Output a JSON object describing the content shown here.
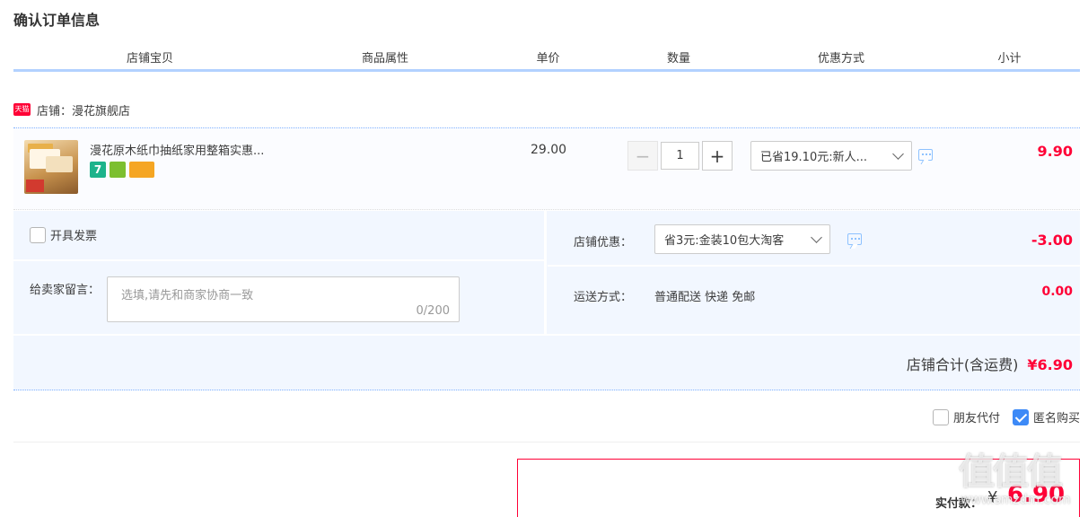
{
  "page": {
    "title": "确认订单信息"
  },
  "columns": [
    "店铺宝贝",
    "商品属性",
    "单价",
    "数量",
    "优惠方式",
    "小计"
  ],
  "shop": {
    "logo_text": "天猫",
    "label": "店铺：漫花旗舰店"
  },
  "item": {
    "title": "漫花原木纸巾抽纸家用整箱实惠...",
    "badge_seven": "7",
    "unit_price": "29.00",
    "quantity": "1",
    "qty_minus": "−",
    "qty_plus": "+",
    "discount_option": "已省19.10元:新人...",
    "subtotal": "9.90"
  },
  "invoice": {
    "label": "开具发票",
    "checked": false
  },
  "message": {
    "label": "给卖家留言：",
    "placeholder": "选填,请先和商家协商一致",
    "counter": "0/200"
  },
  "shop_discount": {
    "label": "店铺优惠：",
    "option": "省3元:金装10包大淘客",
    "amount": "-3.00"
  },
  "shipping": {
    "label": "运送方式：",
    "value": "普通配送 快递 免邮",
    "amount": "0.00"
  },
  "shop_total": {
    "label": "店铺合计(含运费)",
    "value": "¥6.90"
  },
  "options": {
    "friend_pay": {
      "label": "朋友代付",
      "checked": false
    },
    "anonymous": {
      "label": "匿名购买",
      "checked": true
    }
  },
  "payment": {
    "label": "实付款：",
    "currency": "¥",
    "amount": "6.90"
  },
  "watermark": {
    "text": "值值值",
    "url": "www.smzdm.com"
  },
  "colors": {
    "accent_red": "#ff0036",
    "header_line": "#b2d1ff",
    "panel_bg": "#f2f7ff",
    "check_blue": "#3d8af7"
  },
  "icons": [
    "tmall-logo-icon",
    "chat-icon",
    "chevron-down-icon",
    "checkbox-icon"
  ]
}
